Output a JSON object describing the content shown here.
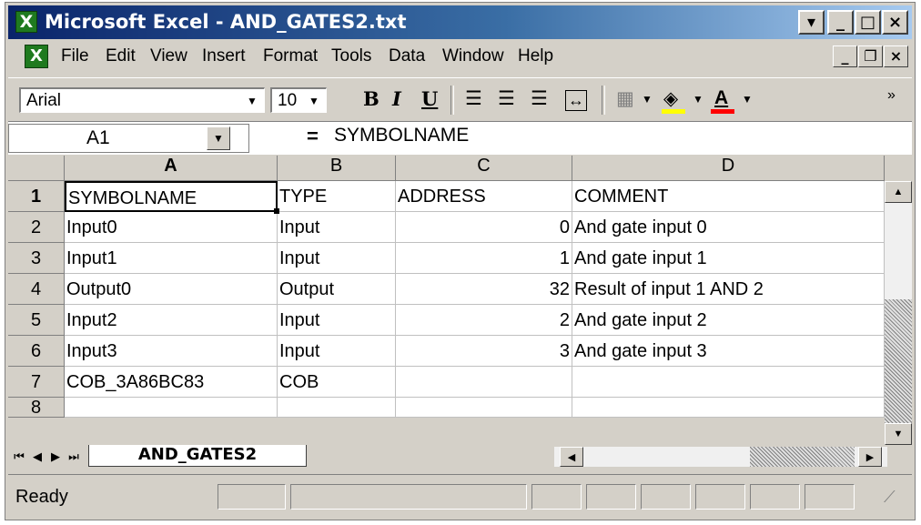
{
  "window": {
    "title": "Microsoft Excel - AND_GATES2.txt"
  },
  "menubar": {
    "items": [
      "File",
      "Edit",
      "View",
      "Insert",
      "Format",
      "Tools",
      "Data",
      "Window",
      "Help"
    ]
  },
  "toolbar": {
    "font": "Arial",
    "size": "10",
    "bold": "B",
    "italic": "I",
    "underline": "U"
  },
  "formula_bar": {
    "name_box": "A1",
    "equals": "=",
    "content": "SYMBOLNAME"
  },
  "grid": {
    "columns": [
      "A",
      "B",
      "C",
      "D"
    ],
    "rows": [
      {
        "num": "1",
        "a": "SYMBOLNAME",
        "b": "TYPE",
        "c": "ADDRESS",
        "d": "COMMENT"
      },
      {
        "num": "2",
        "a": "Input0",
        "b": "Input",
        "c": "0",
        "d": "And gate input 0"
      },
      {
        "num": "3",
        "a": "Input1",
        "b": "Input",
        "c": "1",
        "d": "And gate input 1"
      },
      {
        "num": "4",
        "a": "Output0",
        "b": "Output",
        "c": "32",
        "d": "Result of input 1 AND 2"
      },
      {
        "num": "5",
        "a": "Input2",
        "b": "Input",
        "c": "2",
        "d": "And gate input 2"
      },
      {
        "num": "6",
        "a": "Input3",
        "b": "Input",
        "c": "3",
        "d": "And gate input 3"
      },
      {
        "num": "7",
        "a": "COB_3A86BC83",
        "b": "COB",
        "c": "",
        "d": ""
      },
      {
        "num": "8",
        "a": "",
        "b": "",
        "c": "",
        "d": ""
      }
    ]
  },
  "sheet_tab": "AND_GATES2",
  "status": "Ready"
}
